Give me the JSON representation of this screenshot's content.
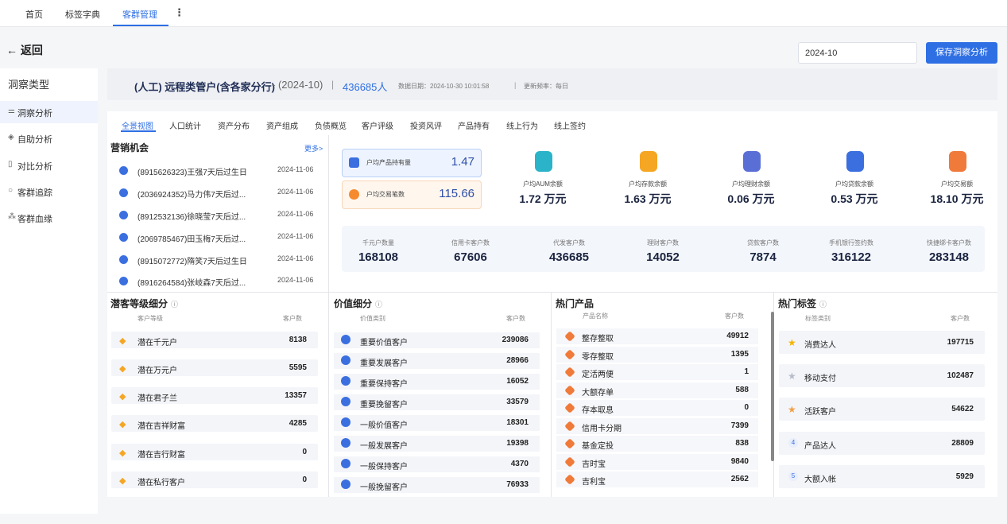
{
  "topnav": {
    "tabs": [
      "首页",
      "标签字典",
      "客群管理"
    ],
    "more": "⋮"
  },
  "back_label": "← 返回",
  "date_value": "2024-10",
  "save_label": "保存洞察分析",
  "sidebar": {
    "heading": "洞察类型",
    "items": [
      {
        "label": "洞察分析",
        "icon": "sliders-icon"
      },
      {
        "label": "自助分析",
        "icon": "stack-icon"
      },
      {
        "label": "对比分析",
        "icon": "compare-icon"
      },
      {
        "label": "客群追踪",
        "icon": "target-icon"
      },
      {
        "label": "客群血缘",
        "icon": "tree-icon"
      }
    ]
  },
  "titlebar": {
    "name": "(人工) 远程类管户(含各家分行)",
    "period": "- (2024-10)",
    "sep": "|",
    "count": "436685人",
    "data_date": "数据日期：2024-10-30 10:01:58",
    "freq": "更新频率：每日"
  },
  "subtabs": [
    "全景视图",
    "人口统计",
    "资产分布",
    "资产组成",
    "负债概览",
    "客户评级",
    "投资风评",
    "产品持有",
    "线上行为",
    "线上签约"
  ],
  "marketing": {
    "title": "营销机会",
    "more": "更多>",
    "items": [
      {
        "text": "(8915626323)王强7天后过生日",
        "date": "2024-11-06"
      },
      {
        "text": "(2036924352)马力伟7天后过...",
        "date": "2024-11-06"
      },
      {
        "text": "(8912532136)徐晓莹7天后过...",
        "date": "2024-11-06"
      },
      {
        "text": "(2069785467)田玉梅7天后过...",
        "date": "2024-11-06"
      },
      {
        "text": "(8915072772)隋笑7天后过生日",
        "date": "2024-11-06"
      },
      {
        "text": "(8916264584)张岐森7天后过...",
        "date": "2024-11-06"
      }
    ]
  },
  "kpis": [
    {
      "label": "户均产品持有量",
      "value": "1.47"
    },
    {
      "label": "户均交易笔数",
      "value": "115.66"
    }
  ],
  "averages": [
    {
      "label": "户均AUM余额",
      "value": "1.72 万元",
      "color": "#2bb3c9"
    },
    {
      "label": "户均存款余额",
      "value": "1.63 万元",
      "color": "#f5a623"
    },
    {
      "label": "户均理财余额",
      "value": "0.06 万元",
      "color": "#5a6fd6"
    },
    {
      "label": "户均贷款余额",
      "value": "0.53 万元",
      "color": "#3b6fe0"
    },
    {
      "label": "户均交易额",
      "value": "18.10 万元",
      "color": "#f07a3a"
    }
  ],
  "stats": [
    {
      "label": "千元户数量",
      "value": "168108"
    },
    {
      "label": "信用卡客户数",
      "value": "67606"
    },
    {
      "label": "代发客户数",
      "value": "436685"
    },
    {
      "label": "理财客户数",
      "value": "14052"
    },
    {
      "label": "贷款客户数",
      "value": "7874"
    },
    {
      "label": "手机银行签约数",
      "value": "316122"
    },
    {
      "label": "快捷绑卡客户数",
      "value": "283148"
    }
  ],
  "potential": {
    "title": "潜客等级细分",
    "col1": "客户等级",
    "col2": "客户数",
    "rows": [
      {
        "name": "潜在千元户",
        "value": "8138"
      },
      {
        "name": "潜在万元户",
        "value": "5595"
      },
      {
        "name": "潜在君子兰",
        "value": "13357"
      },
      {
        "name": "潜在吉祥财富",
        "value": "4285"
      },
      {
        "name": "潜在吉行财富",
        "value": "0"
      },
      {
        "name": "潜在私行客户",
        "value": "0"
      }
    ]
  },
  "value_seg": {
    "title": "价值细分",
    "col1": "价值类别",
    "col2": "客户数",
    "rows": [
      {
        "name": "重要价值客户",
        "value": "239086"
      },
      {
        "name": "重要发展客户",
        "value": "28966"
      },
      {
        "name": "重要保持客户",
        "value": "16052"
      },
      {
        "name": "重要挽留客户",
        "value": "33579"
      },
      {
        "name": "一般价值客户",
        "value": "18301"
      },
      {
        "name": "一般发展客户",
        "value": "19398"
      },
      {
        "name": "一般保持客户",
        "value": "4370"
      },
      {
        "name": "一般挽留客户",
        "value": "76933"
      }
    ]
  },
  "hot_products": {
    "title": "热门产品",
    "col1": "产品名称",
    "col2": "客户数",
    "rows": [
      {
        "name": "整存整取",
        "value": "49912"
      },
      {
        "name": "零存整取",
        "value": "1395"
      },
      {
        "name": "定活两便",
        "value": "1"
      },
      {
        "name": "大额存单",
        "value": "588"
      },
      {
        "name": "存本取息",
        "value": "0"
      },
      {
        "name": "信用卡分期",
        "value": "7399"
      },
      {
        "name": "基金定投",
        "value": "838"
      },
      {
        "name": "吉时宝",
        "value": "9840"
      },
      {
        "name": "吉利宝",
        "value": "2562"
      }
    ]
  },
  "hot_tags": {
    "title": "热门标签",
    "col1": "标签类别",
    "col2": "客户数",
    "rows": [
      {
        "rank": "1",
        "name": "消费达人",
        "value": "197715"
      },
      {
        "rank": "2",
        "name": "移动支付",
        "value": "102487"
      },
      {
        "rank": "3",
        "name": "活跃客户",
        "value": "54622"
      },
      {
        "rank": "4",
        "name": "产品达人",
        "value": "28809"
      },
      {
        "rank": "5",
        "name": "大额入帐",
        "value": "5929"
      }
    ]
  }
}
